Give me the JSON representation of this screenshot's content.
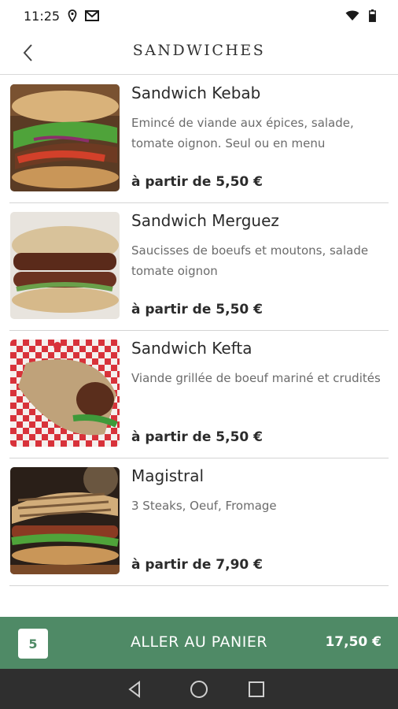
{
  "status_bar": {
    "time": "11:25",
    "icons": [
      "location-icon",
      "gmail-icon",
      "wifi-icon",
      "battery-icon"
    ]
  },
  "header": {
    "title": "SANDWICHES",
    "back_icon": "chevron-left-icon"
  },
  "products": [
    {
      "name": "Sandwich Kebab",
      "description": "Emincé de viande aux épices, salade, tomate oignon. Seul ou en menu",
      "price": "à partir de 5,50 €"
    },
    {
      "name": "Sandwich Merguez",
      "description": "Saucisses de boeufs et moutons, salade tomate oignon",
      "price": "à partir de 5,50 €"
    },
    {
      "name": "Sandwich Kefta",
      "description": "Viande grillée de boeuf mariné et crudités",
      "price": "à partir de 5,50 €"
    },
    {
      "name": "Magistral",
      "description": "3 Steaks, Oeuf, Fromage",
      "price": "à partir de 7,90 €"
    }
  ],
  "cart": {
    "count": "5",
    "label": "ALLER AU PANIER",
    "total": "17,50 €",
    "color": "#4f8a66"
  },
  "nav_bar": {
    "icons": [
      "back-triangle-icon",
      "home-circle-icon",
      "recents-square-icon"
    ]
  }
}
